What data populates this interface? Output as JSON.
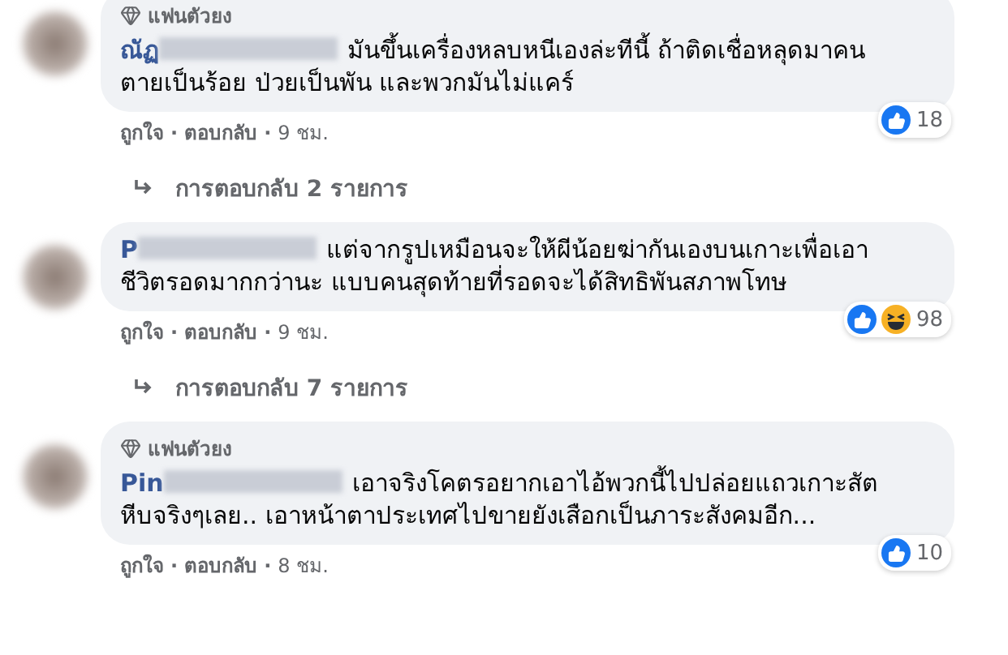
{
  "comments": [
    {
      "badge": "แฟนตัวยง",
      "author": "ณัฏ",
      "text": "มันขึ้นเครื่องหลบหนีเองล่ะทีนี้ ถ้าติดเชื่อหลุดมาคน ตายเป็นร้อย ป่วยเป็นพัน และพวกมันไม่แคร์",
      "reactions": [
        {
          "kind": "like"
        }
      ],
      "reaction_count": "18",
      "actions": [
        {
          "kind": "link",
          "text": "ถูกใจ"
        },
        {
          "kind": "dot",
          "text": "·"
        },
        {
          "kind": "link",
          "text": "ตอบกลับ"
        },
        {
          "kind": "dot",
          "text": "·"
        },
        {
          "kind": "time",
          "text": "9 ชม."
        }
      ],
      "replies": "การตอบกลับ 2 รายการ"
    },
    {
      "author": "P",
      "text": "แต่จากรูปเหมือนจะให้ผีน้อยฆ่ากันเองบนเกาะเพื่อเอาชีวิตรอดมากกว่านะ แบบคนสุดท้ายที่รอดจะได้สิทธิพันสภาพโทษ",
      "reactions": [
        {
          "kind": "like"
        },
        {
          "kind": "haha"
        }
      ],
      "reaction_count": "98",
      "actions": [
        {
          "kind": "link",
          "text": "ถูกใจ"
        },
        {
          "kind": "dot",
          "text": "·"
        },
        {
          "kind": "link",
          "text": "ตอบกลับ"
        },
        {
          "kind": "dot",
          "text": "·"
        },
        {
          "kind": "time",
          "text": "9 ชม."
        }
      ],
      "replies": "การตอบกลับ 7 รายการ"
    },
    {
      "badge": "แฟนตัวยง",
      "author": "Pin",
      "text": "เอาจริงโคตรอยากเอาไอ้พวกนี้ไปปล่อยแถวเกาะสัตหีบจริงๆเลย.. เอาหน้าตาประเทศไปขายยังเสือกเป็นภาระสังคมอีก...",
      "reactions": [
        {
          "kind": "like"
        }
      ],
      "reaction_count": "10",
      "actions": [
        {
          "kind": "link",
          "text": "ถูกใจ"
        },
        {
          "kind": "dot",
          "text": "·"
        },
        {
          "kind": "link",
          "text": "ตอบกลับ"
        },
        {
          "kind": "dot",
          "text": "·"
        },
        {
          "kind": "time",
          "text": "8 ชม."
        }
      ]
    }
  ]
}
